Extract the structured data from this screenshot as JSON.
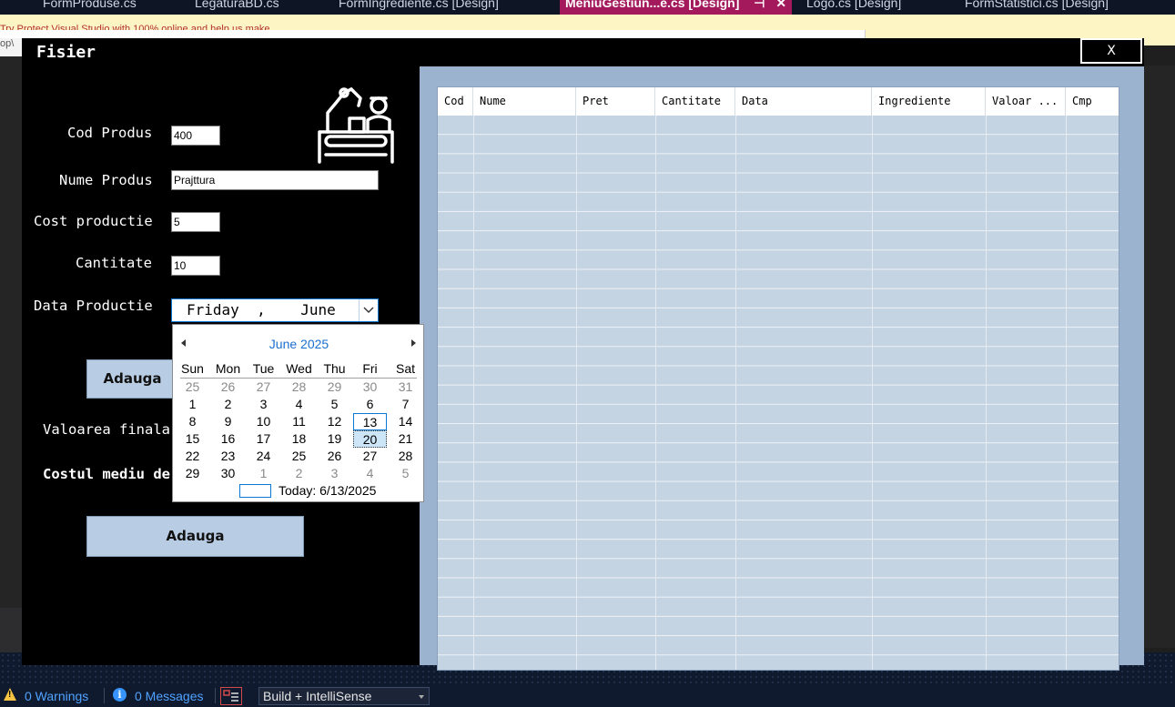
{
  "vs": {
    "tabs": [
      {
        "label": "FormProduse.cs"
      },
      {
        "label": "LegaturaBD.cs"
      },
      {
        "label": "FormIngrediente.cs [Design]"
      },
      {
        "label": "MeniuGestiun...e.cs [Design]",
        "pin": "⊣",
        "close": "✕"
      },
      {
        "label": "Logo.cs [Design]"
      },
      {
        "label": "FormStatistici.cs [Design]"
      }
    ],
    "infobar_text": "Try Protect Visual Studio with 100% online and help us make...",
    "side_text": "op\\",
    "status": {
      "warnings": "0 Warnings",
      "messages": "0 Messages",
      "build_mode": "Build + IntelliSense"
    }
  },
  "form": {
    "title": "Fisier",
    "close_label": "X",
    "fields": {
      "cod": {
        "label": "Cod Produs",
        "value": "400"
      },
      "nume": {
        "label": "Nume Produs",
        "value": "Prajttura"
      },
      "cost": {
        "label": "Cost productie",
        "value": "5"
      },
      "cantitate": {
        "label": "Cantitate",
        "value": "10"
      },
      "data": {
        "label": "Data Productie",
        "value": "Friday  ,    June"
      }
    },
    "add_button_1": "Adauga",
    "add_button_2": "Adauga",
    "valoare_label": "Valoarea finala",
    "cost_mediu_label": "Costul mediu de productie",
    "grid": {
      "columns": [
        "Cod",
        "Nume",
        "Pret",
        "Cantitate",
        "Data",
        "Ingrediente",
        "Valoar ...",
        "Cmp"
      ]
    }
  },
  "calendar": {
    "month_title": "June 2025",
    "weekdays": [
      "Sun",
      "Mon",
      "Tue",
      "Wed",
      "Thu",
      "Fri",
      "Sat"
    ],
    "weeks": [
      [
        "25",
        "26",
        "27",
        "28",
        "29",
        "30",
        "31"
      ],
      [
        "1",
        "2",
        "3",
        "4",
        "5",
        "6",
        "7"
      ],
      [
        "8",
        "9",
        "10",
        "11",
        "12",
        "13",
        "14"
      ],
      [
        "15",
        "16",
        "17",
        "18",
        "19",
        "20",
        "21"
      ],
      [
        "22",
        "23",
        "24",
        "25",
        "26",
        "27",
        "28"
      ],
      [
        "29",
        "30",
        "1",
        "2",
        "3",
        "4",
        "5"
      ]
    ],
    "today_day": "13",
    "selected_day": "20",
    "today_label": "Today: 6/13/2025",
    "colors": {
      "accent": "#1b6fd0",
      "selected_bg": "#cde6f7",
      "today_border": "#0b78d4"
    }
  }
}
